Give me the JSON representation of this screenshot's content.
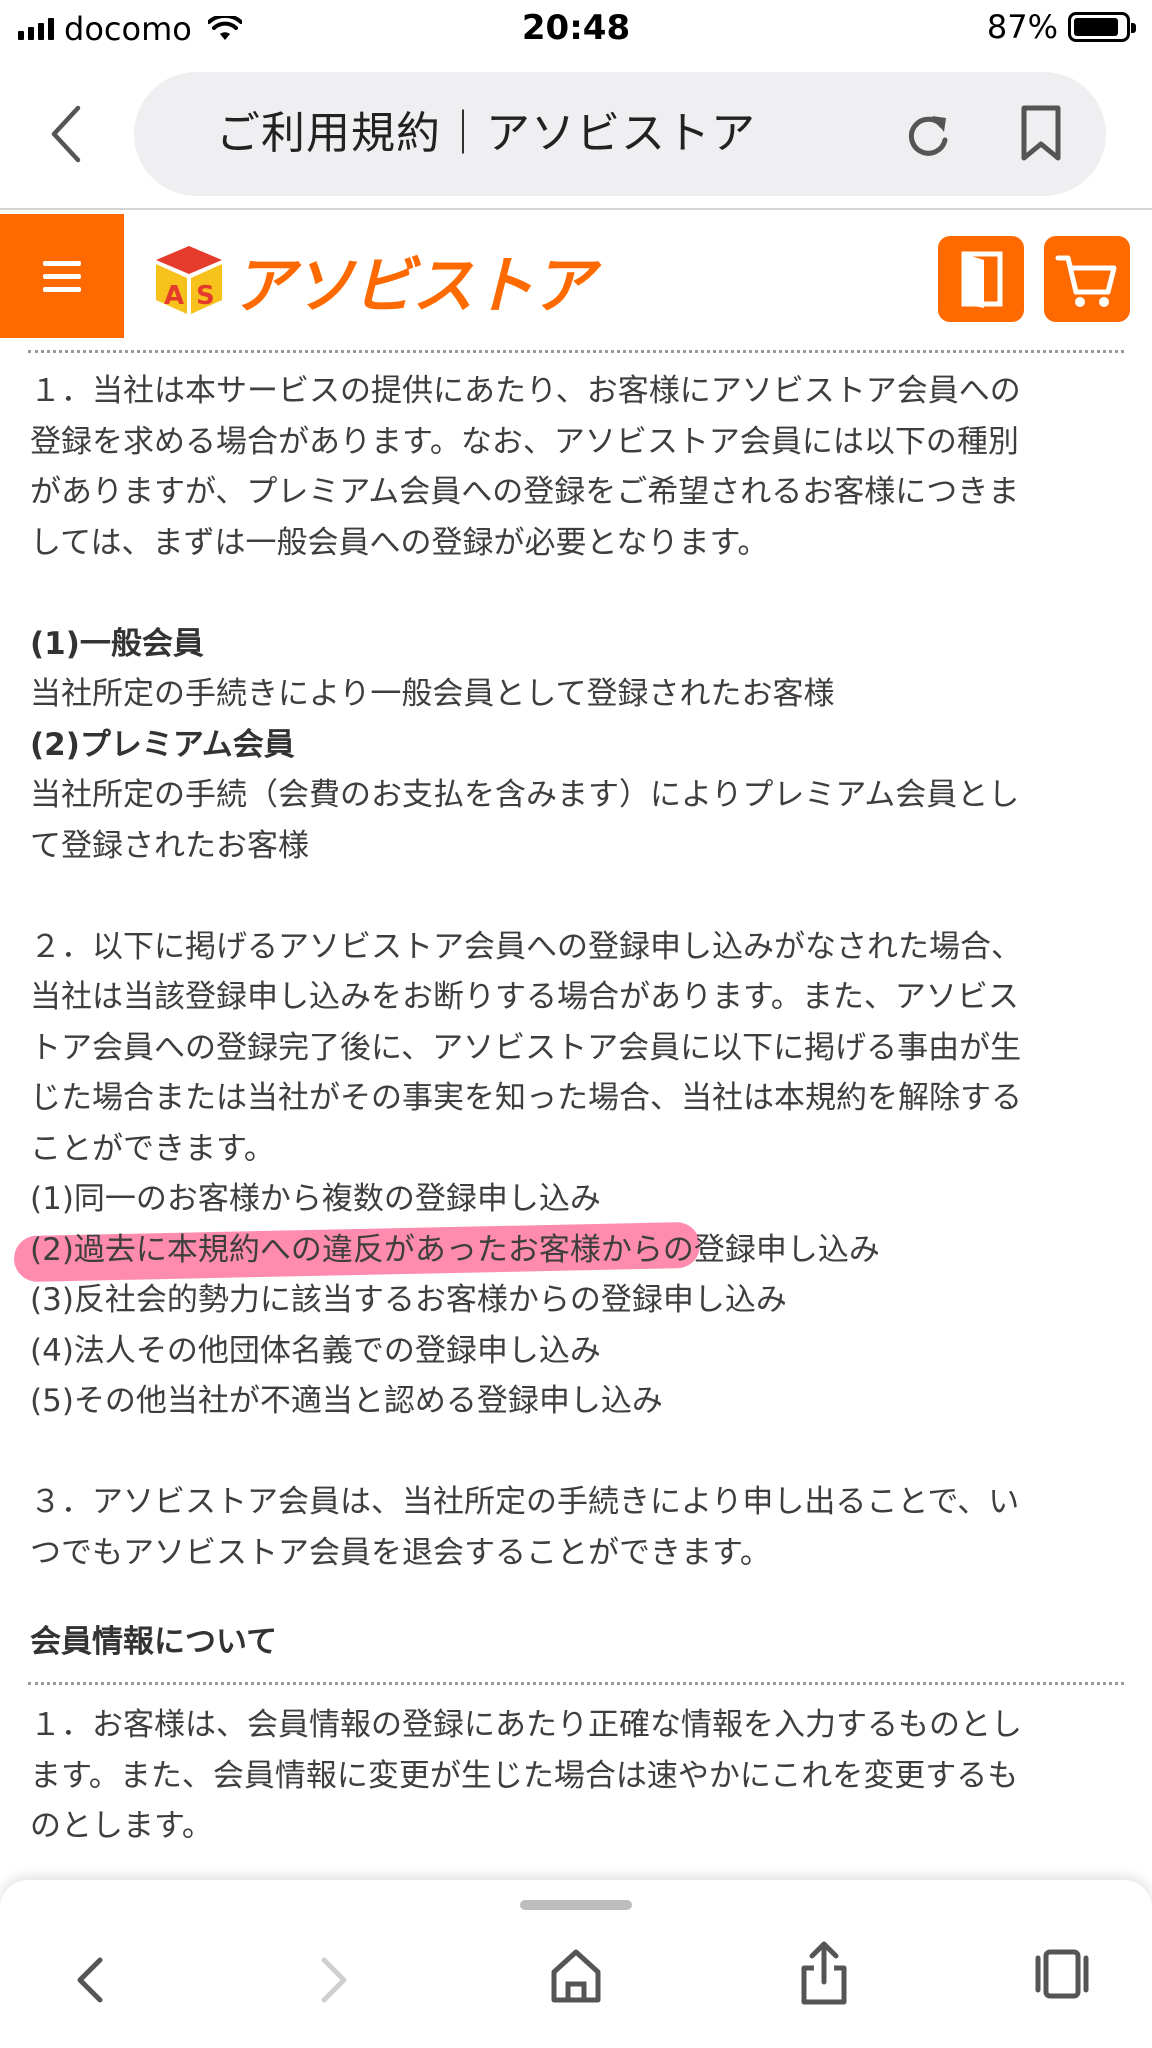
{
  "status_bar": {
    "carrier": "docomo",
    "time": "20:48",
    "battery_percent_text": "87%",
    "battery_level": 0.87
  },
  "browser": {
    "page_title": "ご利用規約｜アソビストア"
  },
  "site": {
    "logo_text": "アソビストア",
    "brand_color": "#ff6a00"
  },
  "terms": {
    "para1": [
      "１．当社は本サービスの提供にあたり、お客様にアソビストア会員への",
      "登録を求める場合があります。なお、アソビストア会員には以下の種別",
      "がありますが、プレミアム会員への登録をご希望されるお客様につきま",
      "しては、まずは一般会員への登録が必要となります。"
    ],
    "general_member_title": "(1)一般会員",
    "general_member_desc": "当社所定の手続きにより一般会員として登録されたお客様",
    "premium_member_title": "(2)プレミアム会員",
    "premium_member_desc": [
      "当社所定の手続（会費のお支払を含みます）によりプレミアム会員とし",
      "て登録されたお客様"
    ],
    "para2": [
      "２．以下に掲げるアソビストア会員への登録申し込みがなされた場合、",
      "当社は当該登録申し込みをお断りする場合があります。また、アソビス",
      "トア会員への登録完了後に、アソビストア会員に以下に掲げる事由が生",
      "じた場合または当社がその事実を知った場合、当社は本規約を解除する",
      "ことができます。"
    ],
    "refusal_items": [
      "(1)同一のお客様から複数の登録申し込み",
      "(2)過去に本規約への違反があったお客様からの登録申し込み",
      "(3)反社会的勢力に該当するお客様からの登録申し込み",
      "(4)法人その他団体名義での登録申し込み",
      "(5)その他当社が不適当と認める登録申し込み"
    ],
    "para3": [
      "３．アソビストア会員は、当社所定の手続きにより申し出ることで、い",
      "つでもアソビストア会員を退会することができます。"
    ]
  },
  "member_info": {
    "title": "会員情報について",
    "para1": [
      "１．お客様は、会員情報の登録にあたり正確な情報を入力するものとし",
      "ます。また、会員情報に変更が生じた場合は速やかにこれを変更するも",
      "のとします。"
    ]
  },
  "annotation": {
    "highlight_color": "#ff2d6d"
  },
  "toolbar": {
    "icons": [
      "back-icon",
      "forward-icon",
      "home-icon",
      "share-icon",
      "tabs-icon"
    ]
  }
}
